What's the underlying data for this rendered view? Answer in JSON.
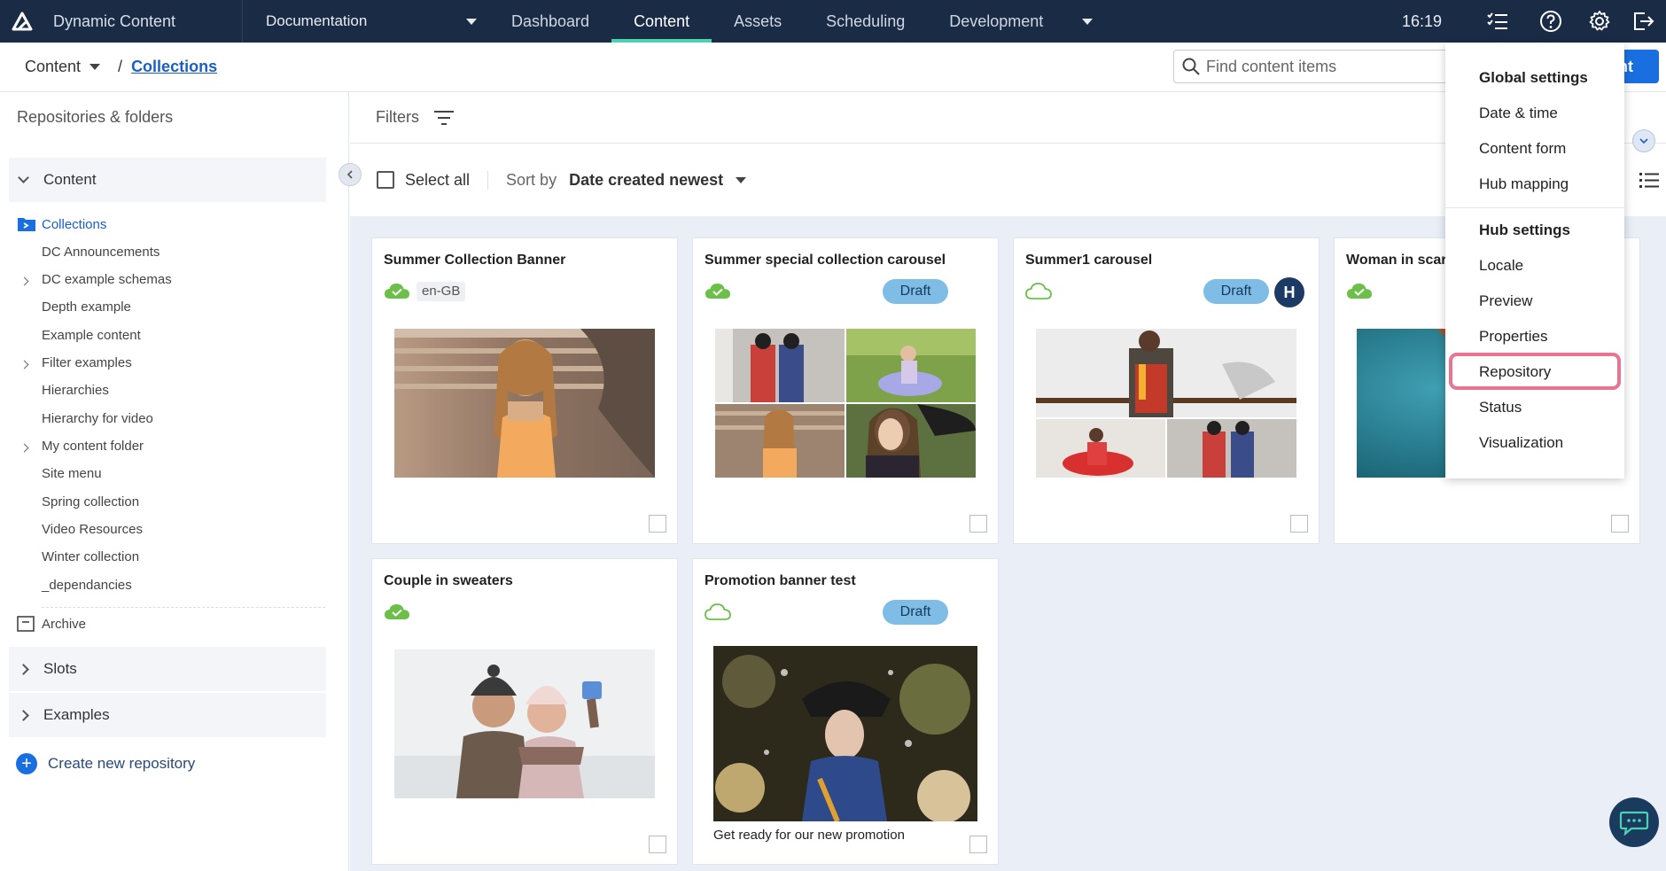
{
  "app": {
    "name": "Dynamic Content",
    "hub": "Documentation",
    "time": "16:19"
  },
  "nav": {
    "items": [
      "Dashboard",
      "Content",
      "Assets",
      "Scheduling",
      "Development"
    ],
    "active": "Content"
  },
  "breadcrumb": {
    "root": "Content",
    "current": "Collections"
  },
  "search": {
    "placeholder": "Find content items"
  },
  "create_button": {
    "label": "nt"
  },
  "sidebar": {
    "title": "Repositories & folders",
    "content_group": "Content",
    "folders": [
      {
        "label": "Collections",
        "active": true,
        "expandable": false
      },
      {
        "label": "DC Announcements",
        "active": false,
        "expandable": false
      },
      {
        "label": "DC example schemas",
        "active": false,
        "expandable": true
      },
      {
        "label": "Depth example",
        "active": false,
        "expandable": false
      },
      {
        "label": "Example content",
        "active": false,
        "expandable": false
      },
      {
        "label": "Filter examples",
        "active": false,
        "expandable": true
      },
      {
        "label": "Hierarchies",
        "active": false,
        "expandable": false
      },
      {
        "label": "Hierarchy for video",
        "active": false,
        "expandable": false
      },
      {
        "label": "My content folder",
        "active": false,
        "expandable": true
      },
      {
        "label": "Site menu",
        "active": false,
        "expandable": false
      },
      {
        "label": "Spring collection",
        "active": false,
        "expandable": false
      },
      {
        "label": "Video Resources",
        "active": false,
        "expandable": false
      },
      {
        "label": "Winter collection",
        "active": false,
        "expandable": false
      },
      {
        "label": "_dependancies",
        "active": false,
        "expandable": false
      }
    ],
    "archive": "Archive",
    "slots": "Slots",
    "examples": "Examples",
    "create_repo": "Create new repository"
  },
  "filters": {
    "label": "Filters"
  },
  "toolbar": {
    "select_all": "Select all",
    "sort_label": "Sort by",
    "sort_value": "Date created newest"
  },
  "cards": [
    {
      "title": "Summer Collection Banner",
      "published": true,
      "locale": "en-GB"
    },
    {
      "title": "Summer special collection carousel",
      "published": true,
      "status": "Draft"
    },
    {
      "title": "Summer1 carousel",
      "published": false,
      "status": "Draft",
      "avatar": "H"
    },
    {
      "title": "Woman in scar",
      "published": true
    },
    {
      "title": "Couple in sweaters",
      "published": true
    },
    {
      "title": "Promotion banner test",
      "published": false,
      "status": "Draft",
      "caption": "Get ready for our new promotion"
    }
  ],
  "settings_menu": {
    "global_heading": "Global settings",
    "global_items": [
      "Date & time",
      "Content form",
      "Hub mapping"
    ],
    "hub_heading": "Hub settings",
    "hub_items": [
      "Locale",
      "Preview",
      "Properties",
      "Repository",
      "Status",
      "Visualization"
    ],
    "highlighted": "Repository"
  },
  "colors": {
    "topbar": "#1a2b45",
    "accent": "#4ad2b3",
    "primary": "#1a6fe0",
    "draft": "#7fbde6",
    "published": "#6cc04a",
    "highlight": "#e0466c",
    "grid_bg": "#e9eef7"
  }
}
